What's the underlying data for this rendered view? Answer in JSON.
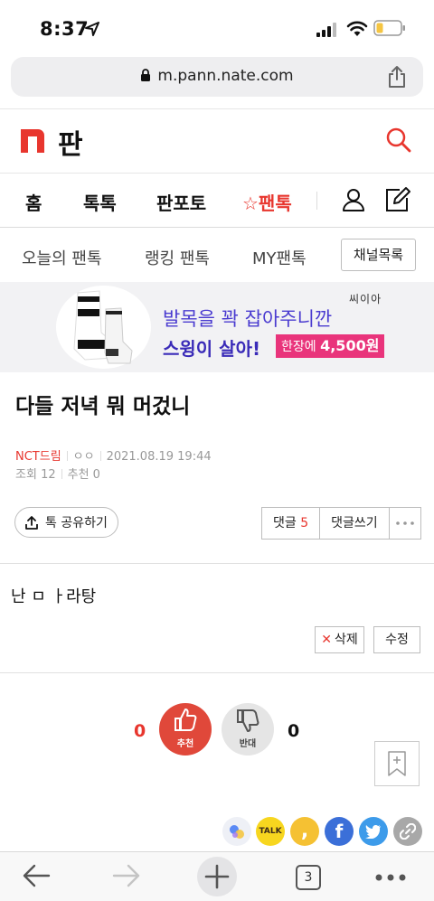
{
  "status_bar": {
    "time": "8:37"
  },
  "browser": {
    "url": "m.pann.nate.com",
    "tab_count": "3"
  },
  "site": {
    "logo_letter": "n",
    "title": "판"
  },
  "main_nav": [
    {
      "label": "홈",
      "active": false
    },
    {
      "label": "톡톡",
      "active": false
    },
    {
      "label": "판포토",
      "active": false
    },
    {
      "label": "☆팬톡",
      "active": true
    }
  ],
  "sub_nav": {
    "items": [
      "오늘의 팬톡",
      "랭킹 팬톡",
      "MY팬톡"
    ],
    "channel_button": "채널목록"
  },
  "ad": {
    "brand": "씨이아",
    "line1": "발목을 꽉 잡아주니깐",
    "line2": "스윙이 살아!",
    "price_prefix": "한장에 ",
    "price": "4,500원"
  },
  "post": {
    "title": "다들 저녁 뭐 머겄니",
    "category": "NCT드림",
    "author": "ㅇㅇ",
    "date": "2021.08.19 19:44",
    "views_label": "조회",
    "views": "12",
    "recommend_label": "추천",
    "recommend": "0",
    "share_button": "톡 공유하기",
    "comments_label": "댓글",
    "comments_count": "5",
    "write_comment": "댓글쓰기",
    "body": "난 ㅁ ㅏ라탕",
    "delete_button": "삭제",
    "edit_button": "수정"
  },
  "votes": {
    "up_count": "0",
    "up_label": "추천",
    "down_count": "0",
    "down_label": "반대"
  },
  "social": {
    "kakaotalk_label": "TALK",
    "kakaostory_label": ",",
    "facebook_label": "f"
  },
  "colors": {
    "accent": "#e8362e",
    "ad_purple": "#4a3bd0",
    "ad_pink": "#e9347b"
  }
}
